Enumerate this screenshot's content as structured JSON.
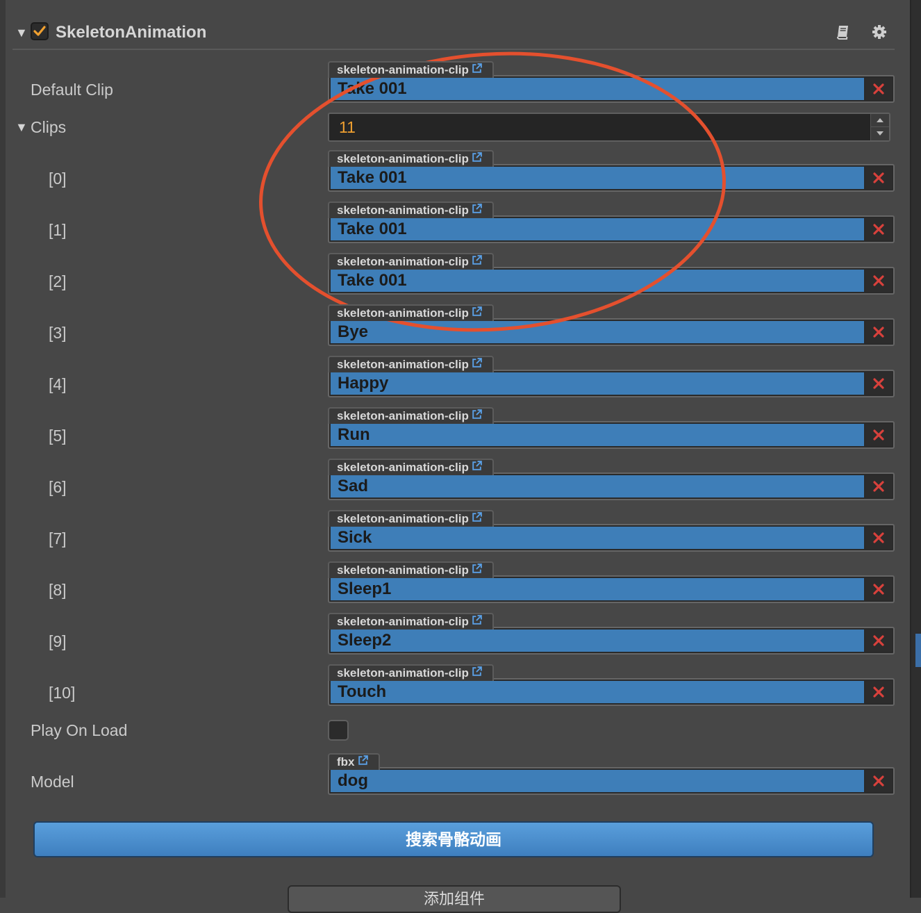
{
  "component": {
    "title": "SkeletonAnimation",
    "enabled": true
  },
  "properties": {
    "default_clip": {
      "label": "Default Clip",
      "asset_type": "skeleton-animation-clip",
      "value": "Take 001"
    },
    "clips": {
      "label": "Clips",
      "count": "11",
      "items": [
        {
          "index": "[0]",
          "asset_type": "skeleton-animation-clip",
          "value": "Take 001"
        },
        {
          "index": "[1]",
          "asset_type": "skeleton-animation-clip",
          "value": "Take 001"
        },
        {
          "index": "[2]",
          "asset_type": "skeleton-animation-clip",
          "value": "Take 001"
        },
        {
          "index": "[3]",
          "asset_type": "skeleton-animation-clip",
          "value": "Bye"
        },
        {
          "index": "[4]",
          "asset_type": "skeleton-animation-clip",
          "value": "Happy"
        },
        {
          "index": "[5]",
          "asset_type": "skeleton-animation-clip",
          "value": "Run"
        },
        {
          "index": "[6]",
          "asset_type": "skeleton-animation-clip",
          "value": "Sad"
        },
        {
          "index": "[7]",
          "asset_type": "skeleton-animation-clip",
          "value": "Sick"
        },
        {
          "index": "[8]",
          "asset_type": "skeleton-animation-clip",
          "value": "Sleep1"
        },
        {
          "index": "[9]",
          "asset_type": "skeleton-animation-clip",
          "value": "Sleep2"
        },
        {
          "index": "[10]",
          "asset_type": "skeleton-animation-clip",
          "value": "Touch"
        }
      ]
    },
    "play_on_load": {
      "label": "Play On Load",
      "checked": false
    },
    "model": {
      "label": "Model",
      "asset_type": "fbx",
      "value": "dog"
    }
  },
  "actions": {
    "search_button": "搜索骨骼动画",
    "add_component_button": "添加组件"
  },
  "colors": {
    "asset_field": "#3e7eb8",
    "clear_icon": "#d8413c",
    "checkbox_check": "#f0a030",
    "annotation_ellipse": "#e4502e",
    "count_value": "#f0a030"
  },
  "icons": {
    "header": [
      "book-icon",
      "gear-icon"
    ],
    "asset_link": "external-link-icon",
    "asset_clear": "close-icon"
  }
}
